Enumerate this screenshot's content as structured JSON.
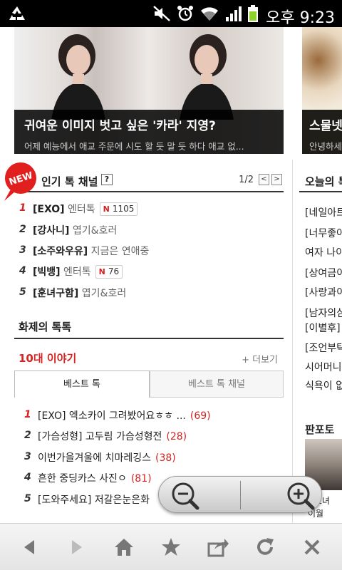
{
  "status": {
    "time": "오후 9:23",
    "icons": [
      "recycle-icon",
      "mute-icon",
      "alarm-icon",
      "wifi-icon",
      "signal-icon",
      "battery-icon"
    ]
  },
  "hero": {
    "card1": {
      "title": "귀여운 이미지 벗고 싶은 '카라' 지영?",
      "sub": "어제 예능에서 애교 주문에 시도 할 듯 말 듯 하다 애교 없..."
    },
    "card2": {
      "title": "스물넷",
      "sub": "안녕하세"
    }
  },
  "popular": {
    "badge": "NEW",
    "title": "인기 톡 채널",
    "help": "?",
    "pager": "1/2",
    "items": [
      {
        "rank": "1",
        "tag": "[EXO]",
        "cat": "엔터톡",
        "badge_n": "N",
        "badge_count": "1105"
      },
      {
        "rank": "2",
        "tag": "[강사니]",
        "cat": "엽기&호러",
        "badge_n": "",
        "badge_count": ""
      },
      {
        "rank": "3",
        "tag": "[소주와우유]",
        "cat": "지금은 연애중",
        "badge_n": "",
        "badge_count": ""
      },
      {
        "rank": "4",
        "tag": "[빅뱅]",
        "cat": "엔터톡",
        "badge_n": "N",
        "badge_count": "76"
      },
      {
        "rank": "5",
        "tag": "[훈녀구함]",
        "cat": "엽기&호러",
        "badge_n": "",
        "badge_count": ""
      }
    ]
  },
  "hot": {
    "title": "화제의 톡톡",
    "top10": "10대 이야기",
    "more": "+ 더보기",
    "tabs": [
      "베스트 톡",
      "베스트 톡 채널"
    ],
    "items": [
      {
        "rank": "1",
        "text": "[EXO] 엑소카이 그려봤어요ㅎㅎ ...",
        "count": "(69)"
      },
      {
        "rank": "2",
        "text": "[가슴성형] 고두림 가슴성형전",
        "count": "(28)"
      },
      {
        "rank": "3",
        "text": "이번가을겨울에 치마레깅스",
        "count": "(38)"
      },
      {
        "rank": "4",
        "text": "흔한 중딩카스 사진ㅇ",
        "count": "(81)"
      },
      {
        "rank": "5",
        "text": "[도와주세요] 저갈은눈은화",
        "count": ""
      }
    ]
  },
  "right": {
    "title": "오늘의 톡",
    "items": [
      "[네일아트",
      "[너무좋아",
      "여자 나이",
      "[상여금이",
      "[사랑과이",
      "[남자의심",
      "[이별후]",
      "[조언부탁",
      "시어머니",
      "식욕이 없"
    ],
    "fan_title": "판포토",
    "fan_caption": "대 소녀",
    "fan_caption2": "이월"
  },
  "bottom_icons": [
    "back-icon",
    "forward-icon",
    "home-icon",
    "bookmark-star-icon",
    "share-icon",
    "refresh-icon",
    "close-icon"
  ],
  "colors": {
    "accent_red": "#d52222",
    "status_bg": "#000000"
  }
}
